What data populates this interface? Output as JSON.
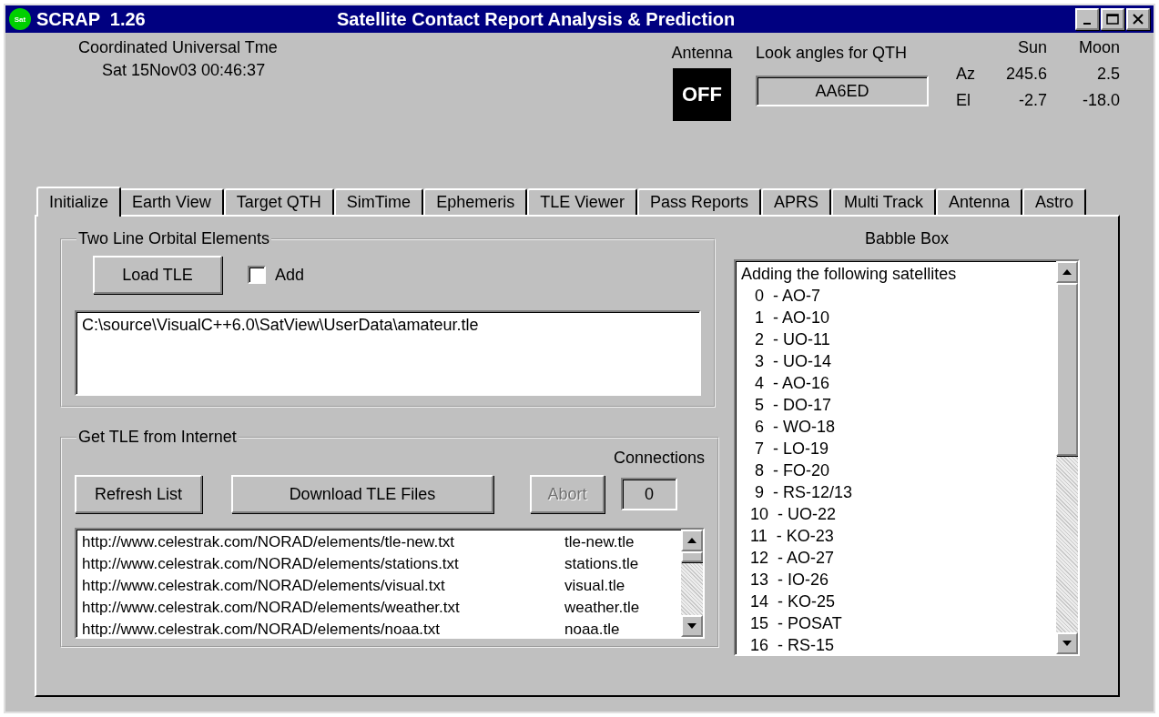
{
  "window": {
    "logo_text": "Sat",
    "title": "SCRAP  1.26",
    "subtitle": "Satellite Contact Report Analysis & Prediction"
  },
  "clock": {
    "label": "Coordinated Universal Tme",
    "value": "Sat 15Nov03 00:46:37"
  },
  "antenna": {
    "label": "Antenna",
    "status": "OFF",
    "on": false
  },
  "look_angles": {
    "label": "Look angles for QTH",
    "value": "AA6ED"
  },
  "sun_moon": {
    "columns": [
      "Sun",
      "Moon"
    ],
    "rows": [
      {
        "label": "Az",
        "sun": "245.6",
        "moon": "2.5"
      },
      {
        "label": "El",
        "sun": "-2.7",
        "moon": "-18.0"
      }
    ]
  },
  "tabs": [
    {
      "label": "Initialize",
      "selected": true
    },
    {
      "label": "Earth View",
      "selected": false
    },
    {
      "label": "Target QTH",
      "selected": false
    },
    {
      "label": "SimTime",
      "selected": false
    },
    {
      "label": "Ephemeris",
      "selected": false
    },
    {
      "label": "TLE Viewer",
      "selected": false
    },
    {
      "label": "Pass Reports",
      "selected": false
    },
    {
      "label": "APRS",
      "selected": false
    },
    {
      "label": "Multi Track",
      "selected": false
    },
    {
      "label": "Antenna",
      "selected": false
    },
    {
      "label": "Astro",
      "selected": false
    }
  ],
  "tle_group": {
    "title": "Two Line Orbital Elements",
    "load_button": "Load TLE",
    "add_checkbox": {
      "label": "Add",
      "checked": false
    },
    "file_path": "C:\\source\\VisualC++6.0\\SatView\\UserData\\amateur.tle"
  },
  "internet_group": {
    "title": "Get TLE from Internet",
    "connections_label": "Connections",
    "connections": "0",
    "buttons": [
      {
        "label": "Refresh List",
        "disabled": false
      },
      {
        "label": "Download TLE Files",
        "disabled": false
      },
      {
        "label": "Abort",
        "disabled": true
      }
    ],
    "sources": [
      {
        "url": "http://www.celestrak.com/NORAD/elements/tle-new.txt",
        "file": "tle-new.tle"
      },
      {
        "url": "http://www.celestrak.com/NORAD/elements/stations.txt",
        "file": "stations.tle"
      },
      {
        "url": "http://www.celestrak.com/NORAD/elements/visual.txt",
        "file": "visual.tle"
      },
      {
        "url": "http://www.celestrak.com/NORAD/elements/weather.txt",
        "file": "weather.tle"
      },
      {
        "url": "http://www.celestrak.com/NORAD/elements/noaa.txt",
        "file": "noaa.tle"
      }
    ]
  },
  "babble_box": {
    "title": "Babble Box",
    "lines": [
      "Adding the following satellites",
      "   0  - AO-7",
      "   1  - AO-10",
      "   2  - UO-11",
      "   3  - UO-14",
      "   4  - AO-16",
      "   5  - DO-17",
      "   6  - WO-18",
      "   7  - LO-19",
      "   8  - FO-20",
      "   9  - RS-12/13",
      "  10  - UO-22",
      "  11  - KO-23",
      "  12  - AO-27",
      "  13  - IO-26",
      "  14  - KO-25",
      "  15  - POSAT",
      "  16  - RS-15"
    ]
  }
}
